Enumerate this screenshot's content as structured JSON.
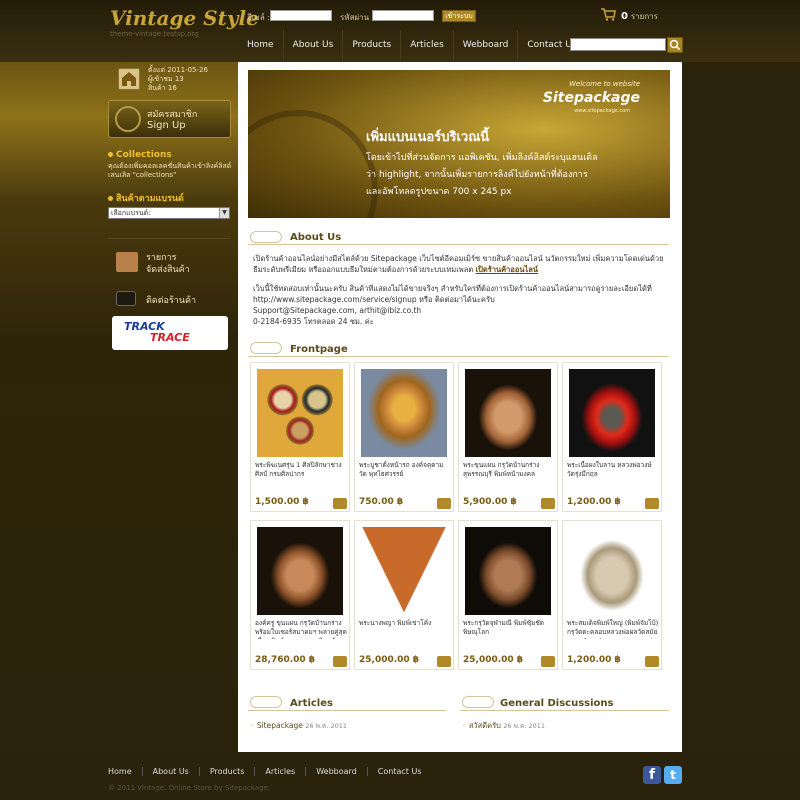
{
  "header": {
    "logo": "Vintage Style",
    "logo_sub": "theme-vintage.testsp.org",
    "email_label": "อีเมล์ :",
    "password_label": "รหัสผ่าน :",
    "login_button": "เข้าระบบ",
    "cart_count": "0",
    "cart_label": "รายการ"
  },
  "nav": [
    "Home",
    "About Us",
    "Products",
    "Articles",
    "Webboard",
    "Contact Us"
  ],
  "search": {
    "placeholder": ""
  },
  "sidebar": {
    "open_label": "ตั้งแต่",
    "open_value": "2011-05-26",
    "visitors_label": "ผู้เข้าชม",
    "visitors_value": "13",
    "products_label": "สินค้า",
    "products_value": "16",
    "signup_th": "สมัครสมาชิก",
    "signup_en": "Sign Up",
    "collections_title": "Collections",
    "collections_text": "คุณต้องเพิ่มคอลเลคชั่นสินค้าเข้าลิงค์ลิสต์เสนเลิส \"collections\"",
    "brand_title": "สินค้าตามแบรนด์",
    "brand_select": "เลือกแบรนด์:",
    "shipping_label_1": "รายการ",
    "shipping_label_2": "จัดส่งสินค้า",
    "contact_label": "ติดต่อร้านค้า",
    "track_1": "TRACK",
    "track_2": "TRACE"
  },
  "banner": {
    "welcome": "Welcome to website",
    "brand": "Sitepackage",
    "brand_sub": "www.sitepackage.com",
    "line1": "เพิ่มแบนเนอร์บริเวณนี้",
    "line2": "โดยเข้าไปที่ส่วนจัดการ แอพิเคชัน, เพิ่มลิงค์ลิสต์ระบุแฮนเดิล",
    "line3": "ว่า highlight, จากนั้นเพิ่มรายการลิงค์ไปยังหน้าที่ต้องการ",
    "line4": "และอัพโหลดรูปขนาด 700 x 245 px"
  },
  "about": {
    "title": "About Us",
    "p1": "เปิดร้านค้าออนไลน์อย่างมีสไตล์ด้วย Sitepackage เว็บไซต์อีคอมเมิร์ซ ขายสินค้าออนไลน์ นวัตกรรมใหม่ เพิ่มความโดดเด่นด้วยธีมระดับพรีเมียม หรือออกแบบธีมใหม่ตามต้องการด้วยระบบเทมเพลต",
    "p1_link": "เปิดร้านค้าออนไลน์",
    "p2": "เว็บนี้ใช้ทดสอบเท่านั้นนะครับ สินค้าที่แสดงไม่ได้ขายจริงๆ สำหรับใครที่ต้องการเปิดร้านค้าออนไลน์สามารถดูรายละเอียดได้ที่",
    "url": "http://www.sitepackage.com/service/signup หรือ ติดต่อมาได้นะครับ",
    "email": "Support@Sitepackage.com, arthit@ibiz.co.th",
    "phone": "0-2184-6935 โทรตลอด 24 ชม. ค่ะ"
  },
  "frontpage": {
    "title": "Frontpage",
    "products": [
      {
        "name": "พระพิฆเนศรุ่น 1 ศิลปิลักษาช่าง ศิลป์ กรมศิลปากร",
        "price": "1,500.00 ฿"
      },
      {
        "name": "พระบูชาตั้งหน้ารถ องค์จตุคาม วัด พุทไธศวรรย์",
        "price": "750.00 ฿"
      },
      {
        "name": "พระขุนแผน กรุวัดบ้านกร่าง สุพรรณบุรี พิมพ์หน้ามงคล",
        "price": "5,900.00 ฿"
      },
      {
        "name": "พระเนื้อผงใบลาน หลวงพ่อวงษ์ วัดรุ่งมีกฤล",
        "price": "1,200.00 ฿"
      },
      {
        "name": "องค์ครู ขุนแผน กรุวัดบ้านกร่าง พร้อมใบเซอร์สมาคมฯ พลายคู่สุดเดี่ยว พิมพ์เทวดา สวยกริบ เข้มๆ",
        "price": "28,760.00 ฿"
      },
      {
        "name": "พระนางพญา พิมพ์เข่าโค้ง",
        "price": "25,000.00 ฿"
      },
      {
        "name": "พระกรุวัดจุฬามณี พิมพ์ซุ้มชัด พิษณุโลก",
        "price": "25,000.00 ฿"
      },
      {
        "name": "พระสมเด็จพิมพ์ใหญ่ (พิมพ์จัมโบ้) กรุวัดตะคลอบหลวงพ่อผลวัดสมัย หลวงปู่ศุข ปากคลองมะขามเฒ่า",
        "price": "1,200.00 ฿"
      }
    ]
  },
  "articles": {
    "title": "Articles",
    "item": "Sitepackage",
    "date": "26 พ.ค. 2011"
  },
  "discussions": {
    "title": "General Discussions",
    "item": "สวัสดีครับ",
    "date": "26 พ.ค. 2011"
  },
  "footer": {
    "links": [
      "Home",
      "About Us",
      "Products",
      "Articles",
      "Webboard",
      "Contact Us"
    ],
    "copyright": "© 2011 Vintage. Online Store by Sitepackage."
  },
  "colors": {
    "gold": "#c9a43a",
    "dark": "#2b230c",
    "facebook": "#3b5998",
    "twitter": "#55acee"
  }
}
